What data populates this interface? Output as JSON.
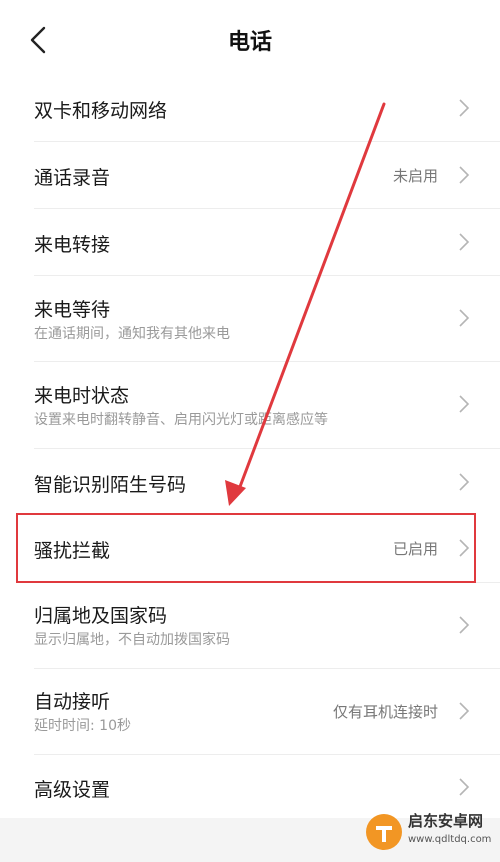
{
  "header": {
    "title": "电话"
  },
  "rows": [
    {
      "label": "双卡和移动网络",
      "sub": "",
      "value": ""
    },
    {
      "label": "通话录音",
      "sub": "",
      "value": "未启用"
    },
    {
      "label": "来电转接",
      "sub": "",
      "value": ""
    },
    {
      "label": "来电等待",
      "sub": "在通话期间，通知我有其他来电",
      "value": ""
    },
    {
      "label": "来电时状态",
      "sub": "设置来电时翻转静音、启用闪光灯或距离感应等",
      "value": ""
    },
    {
      "label": "智能识别陌生号码",
      "sub": "",
      "value": ""
    },
    {
      "label": "骚扰拦截",
      "sub": "",
      "value": "已启用"
    },
    {
      "label": "归属地及国家码",
      "sub": "显示归属地，不自动加拨国家码",
      "value": ""
    },
    {
      "label": "自动接听",
      "sub": "延时时间: 10秒",
      "value": "仅有耳机连接时"
    },
    {
      "label": "高级设置",
      "sub": "",
      "value": ""
    }
  ],
  "watermark": {
    "name": "启东安卓网",
    "url": "www.qdltdq.com"
  },
  "colors": {
    "highlight": "#e0393e",
    "watermark_accent": "#f29624"
  }
}
